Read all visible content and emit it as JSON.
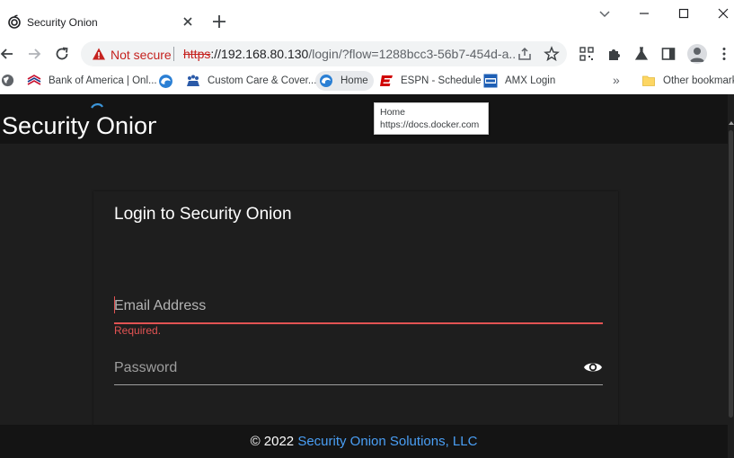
{
  "browser": {
    "tab": {
      "title": "Security Onion"
    },
    "address_bar": {
      "security_label": "Not secure",
      "url_scheme": "https",
      "url_host": "://192.168.80.130",
      "url_rest": "/login/?flow=1288bcc3-56b7-454d-a..."
    },
    "bookmarks": [
      {
        "label": "Bank of America | Onl...",
        "icon": "bank-of-america-icon"
      },
      {
        "label": "Custom Care & Cover...",
        "icon": "custom-care-icon"
      },
      {
        "label": "Home",
        "icon": "docker-home-icon"
      },
      {
        "label": "ESPN - Schedule",
        "icon": "espn-icon"
      },
      {
        "label": "AMX Login",
        "icon": "amx-icon"
      }
    ],
    "more_bookmarks": "»",
    "other_bookmarks": "Other bookmarks",
    "tooltip": {
      "title": "Home",
      "url": "https://docs.docker.com"
    }
  },
  "app": {
    "logo_text": "Security Onion",
    "login_title": "Login to Security Onion",
    "email_placeholder": "Email Address",
    "email_error": "Required.",
    "password_placeholder": "Password",
    "footer_prefix": "© 2022 ",
    "footer_link": "Security Onion Solutions, LLC"
  },
  "colors": {
    "page_background": "#1e1e1e",
    "appbar_background": "#141414",
    "error_red": "#e25353",
    "footer_link_blue": "#4a9ff5",
    "not_secure_red": "#c5221f"
  }
}
